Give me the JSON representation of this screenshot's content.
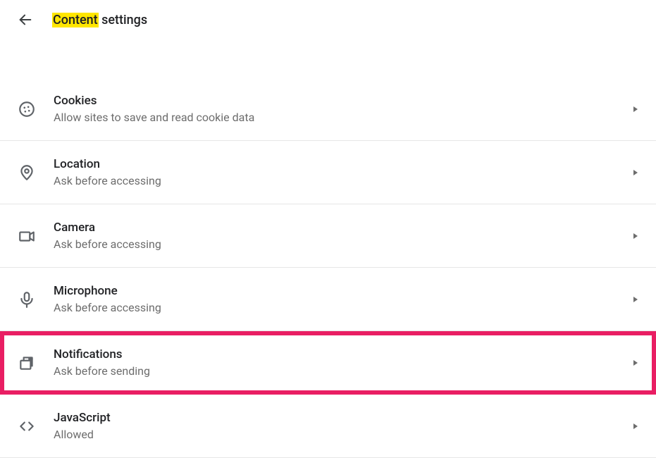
{
  "header": {
    "title_highlighted": "Content",
    "title_rest": " settings"
  },
  "items": [
    {
      "icon": "cookie",
      "title": "Cookies",
      "subtitle": "Allow sites to save and read cookie data",
      "name": "cookies",
      "highlight": false
    },
    {
      "icon": "location",
      "title": "Location",
      "subtitle": "Ask before accessing",
      "name": "location",
      "highlight": false
    },
    {
      "icon": "camera",
      "title": "Camera",
      "subtitle": "Ask before accessing",
      "name": "camera",
      "highlight": false
    },
    {
      "icon": "mic",
      "title": "Microphone",
      "subtitle": "Ask before accessing",
      "name": "microphone",
      "highlight": false
    },
    {
      "icon": "bell",
      "title": "Notifications",
      "subtitle": "Ask before sending",
      "name": "notifications",
      "highlight": true
    },
    {
      "icon": "code",
      "title": "JavaScript",
      "subtitle": "Allowed",
      "name": "javascript",
      "highlight": false
    }
  ]
}
